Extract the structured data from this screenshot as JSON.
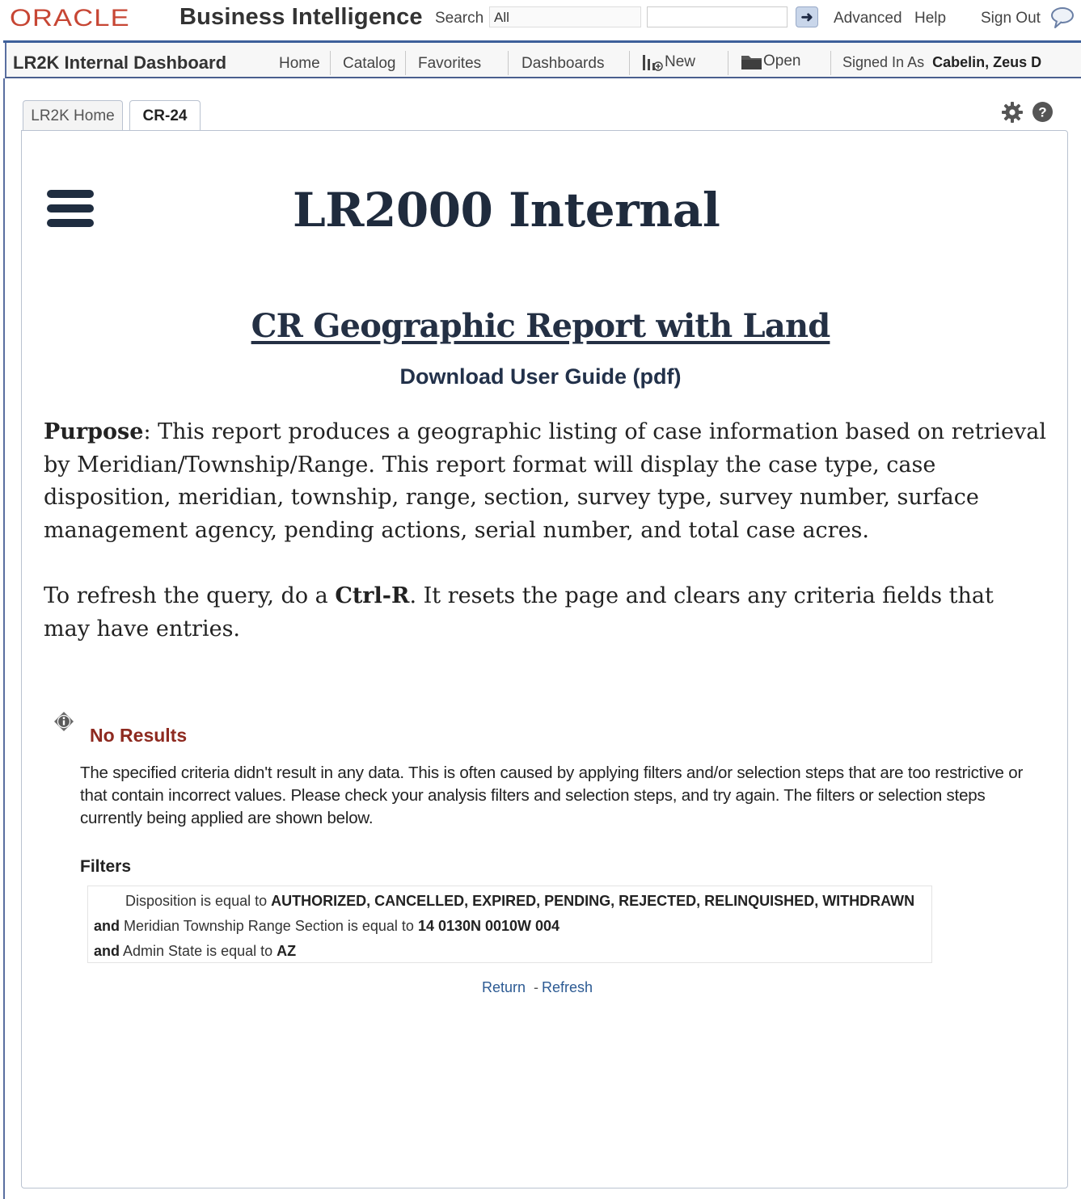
{
  "brand": {
    "logo_text": "ORACLE",
    "product_title": "Business Intelligence"
  },
  "search": {
    "label": "Search",
    "scope_value": "All",
    "query_value": ""
  },
  "top_links": {
    "advanced": "Advanced",
    "help": "Help",
    "sign_out": "Sign Out"
  },
  "nav": {
    "dashboard_title": "LR2K Internal Dashboard",
    "home": "Home",
    "catalog": "Catalog",
    "favorites": "Favorites",
    "dashboards": "Dashboards",
    "new": "New",
    "open": "Open",
    "signed_in_label": "Signed In As",
    "signed_in_user": "Cabelin, Zeus D"
  },
  "tabs": [
    {
      "label": "LR2K Home",
      "active": false
    },
    {
      "label": "CR-24",
      "active": true
    }
  ],
  "content": {
    "main_title": "LR2000 Internal",
    "report_title": "CR Geographic Report with Land",
    "guide_link": "Download User Guide (pdf)",
    "purpose_label": "Purpose",
    "purpose_text": ": This report produces a geographic listing of case information based on retrieval by Meridian/Township/Range. This report format will display the case type, case disposition, meridian, township, range, section, survey type, survey number, surface management agency, pending actions, serial number, and total case acres.",
    "refresh_pre": "To refresh the query, do a ",
    "refresh_key": "Ctrl-R",
    "refresh_post": ". It resets the page and clears any criteria fields that may have entries."
  },
  "no_results": {
    "title": "No Results",
    "message": "The specified criteria didn't result in any data. This is often caused by applying filters and/or selection steps that are too restrictive or that contain incorrect values. Please check your analysis filters and selection steps, and try again. The filters or selection steps currently being applied are shown below.",
    "filters_heading": "Filters",
    "filters": [
      {
        "conj": "",
        "field": "Disposition is equal to",
        "value": "AUTHORIZED, CANCELLED, EXPIRED, PENDING, REJECTED, RELINQUISHED, WITHDRAWN"
      },
      {
        "conj": "and",
        "field": "Meridian Township Range Section is equal to",
        "value": "14 0130N 0010W 004"
      },
      {
        "conj": "and",
        "field": "Admin State is equal to",
        "value": "AZ"
      }
    ],
    "return_link": "Return",
    "link_separator": "-",
    "refresh_link": "Refresh"
  },
  "colors": {
    "oracle_red": "#c74634",
    "header_rule": "#3d5f9a",
    "no_results_title": "#8e2a20",
    "link_blue": "#2c5a93",
    "title_dark": "#1f2b3d"
  },
  "icons": [
    "search-go-icon",
    "chat-bubble-icon",
    "new-chart-icon",
    "folder-open-icon",
    "gear-icon",
    "help-circle-icon",
    "hamburger-menu-icon",
    "info-icon"
  ]
}
